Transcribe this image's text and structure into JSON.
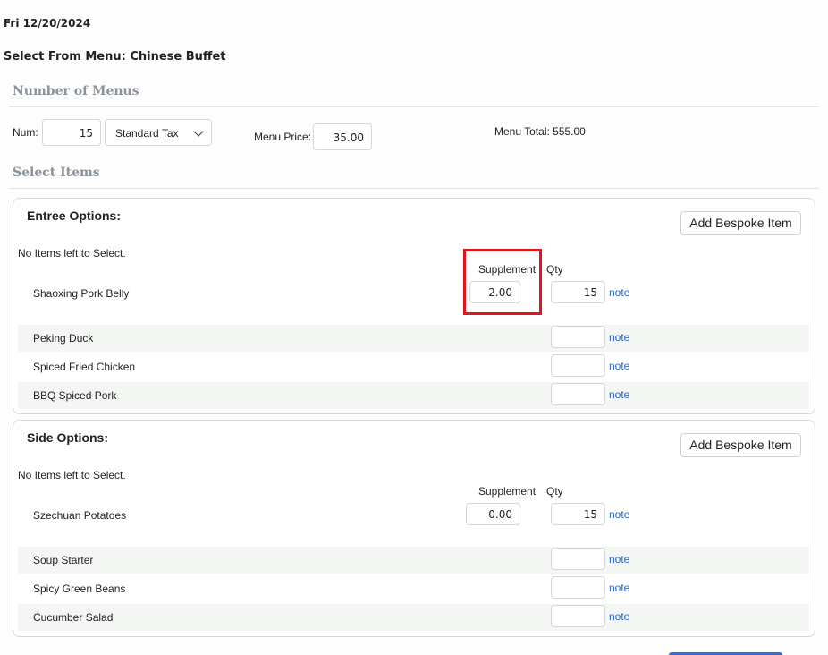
{
  "header": {
    "date": "Fri 12/20/2024",
    "menu_title": "Select From Menu: Chinese Buffet"
  },
  "number_section": {
    "title": "Number of Menus",
    "num_label": "Num:",
    "num_value": "15",
    "tax_selected": "Standard Tax",
    "price_label": "Menu Price:",
    "price_value": "35.00",
    "total_text": "Menu Total: 555.00"
  },
  "select_section": {
    "title": "Select Items"
  },
  "entree": {
    "title": "Entree Options:",
    "bespoke_label": "Add Bespoke Item",
    "status": "No Items left to Select.",
    "supplement_header": "Supplement",
    "qty_header": "Qty",
    "items": [
      {
        "name": "Shaoxing Pork Belly",
        "supplement": "2.00",
        "qty": "15",
        "note": "note"
      },
      {
        "name": "Peking Duck",
        "qty": "",
        "note": "note"
      },
      {
        "name": "Spiced Fried Chicken",
        "qty": "",
        "note": "note"
      },
      {
        "name": "BBQ Spiced Pork",
        "qty": "",
        "note": "note"
      }
    ]
  },
  "side": {
    "title": "Side Options:",
    "bespoke_label": "Add Bespoke Item",
    "status": "No Items left to Select.",
    "supplement_header": "Supplement",
    "qty_header": "Qty",
    "items": [
      {
        "name": "Szechuan Potatoes",
        "supplement": "0.00",
        "qty": "15",
        "note": "note"
      },
      {
        "name": "Soup Starter",
        "qty": "",
        "note": "note"
      },
      {
        "name": "Spicy Green Beans",
        "qty": "",
        "note": "note"
      },
      {
        "name": "Cucumber Salad",
        "qty": "",
        "note": "note"
      }
    ]
  },
  "colors": {
    "highlight": "#e0141e",
    "link": "#2266cc",
    "primary_button": "#2f6fd6",
    "section_title": "#8a929c"
  },
  "icons": {
    "tax_dropdown": "chevron-down-icon"
  }
}
